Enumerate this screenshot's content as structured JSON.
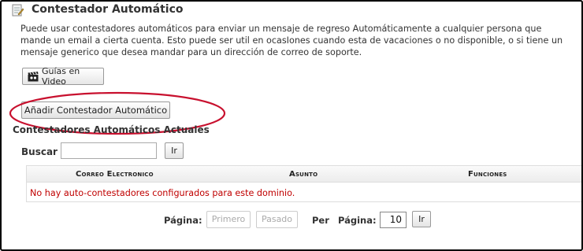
{
  "section": {
    "title": "Contestador Automático",
    "description": "Puede usar contestadores automáticos para enviar un mensaje de regreso Automáticamente a cualquier persona que mande un email a cierta cuenta. Esto puede ser util en ocasIones cuando esta de vacaciones o no disponible, o si tiene un mensaje generico que desea mandar para un dirección de correo de soporte."
  },
  "buttons": {
    "video_label": "Guías en Video",
    "add_label": "Añadir Contestador Automático"
  },
  "list": {
    "title": "Contestadores Automáticos Actuales",
    "search_label": "Buscar",
    "search_value": "",
    "go_label": "Ir",
    "columns": [
      "Correo Electronico",
      "Asunto",
      "Funciones"
    ],
    "empty_message": "No hay auto-contestadores configurados para este dominio."
  },
  "pagination": {
    "page_label": "Página:",
    "first_label": "Primero",
    "prev_label": "Pasado",
    "per_label": "Per",
    "per_page_label": "Página:",
    "per_page_value": "10",
    "go_label": "Ir"
  },
  "colors": {
    "highlight_oval": "#c8102e",
    "empty_message": "#c00000"
  },
  "icons": {
    "title": "note-pencil-icon",
    "video": "clapperboard-icon"
  }
}
